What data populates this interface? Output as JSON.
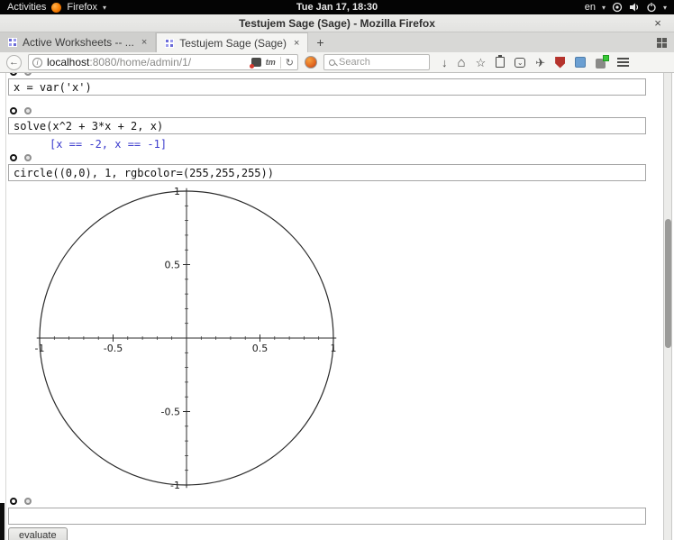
{
  "desktop": {
    "activities_label": "Activities",
    "app_menu_label": "Firefox",
    "clock": "Tue Jan 17, 18:30",
    "keyboard_layout": "en"
  },
  "window": {
    "title": "Testujem Sage (Sage) - Mozilla Firefox"
  },
  "tabs": [
    {
      "label": "Active Worksheets -- ...",
      "active": false
    },
    {
      "label": "Testujem Sage (Sage)",
      "active": true
    }
  ],
  "navbar": {
    "url_host": "localhost",
    "url_rest": ":8080/home/admin/1/",
    "search_placeholder": "Search"
  },
  "icons": {
    "close": "×",
    "tab_close": "×",
    "new_tab": "+",
    "caret": "▾",
    "back": "←",
    "reload": "↻",
    "info": "i",
    "extension_b": "tm",
    "download": "↓",
    "home": "⌂",
    "star": "☆",
    "pocket_chevron": "⌄",
    "send": "✈"
  },
  "notebook": {
    "cells": [
      {
        "input": "x = var('x')",
        "output": ""
      },
      {
        "input": "solve(x^2 + 3*x + 2, x)",
        "output": "[x == -2, x == -1]"
      },
      {
        "input": "circle((0,0), 1, rgbcolor=(255,255,255))",
        "output": ""
      },
      {
        "input": "",
        "output": ""
      }
    ],
    "evaluate_label": "evaluate"
  },
  "chart_data": {
    "type": "line",
    "title": "",
    "description": "Unit circle centered at the origin with axes through (0,0)",
    "circle": {
      "cx": 0,
      "cy": 0,
      "r": 1
    },
    "xlim": [
      -1.02,
      1.02
    ],
    "ylim": [
      -1.02,
      1.02
    ],
    "x_ticks": [
      -1,
      -0.5,
      0.5,
      1
    ],
    "y_ticks": [
      -1,
      -0.5,
      0.5,
      1
    ],
    "x_tick_labels": [
      "-1",
      "-0.5",
      "0.5",
      "1"
    ],
    "y_tick_labels": [
      "-1",
      "-0.5",
      "0.5",
      "1"
    ],
    "minor_tick_step": 0.1,
    "grid": false,
    "legend": false
  },
  "colors": {
    "output_text": "#3c3ccd",
    "plot_stroke": "#2b2b2b",
    "topbar_bg": "#040404",
    "chrome_bg": "#f4f4f2"
  }
}
